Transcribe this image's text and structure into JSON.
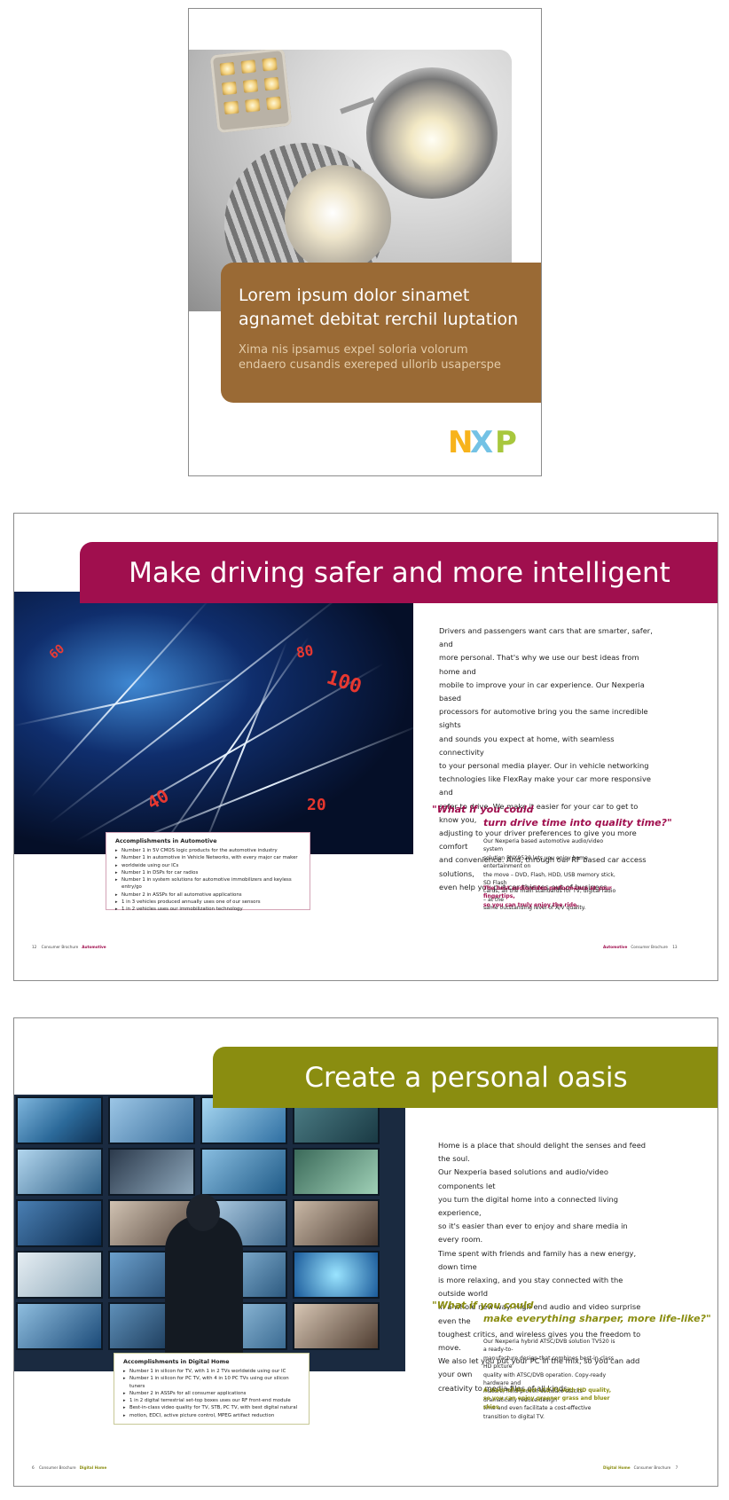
{
  "cover": {
    "title_line1": "Lorem ipsum dolor sinamet",
    "title_line2": "agnamet debitat rerchil luptation",
    "subtitle_line1": "Xima nis ipsamus expel soloria volorum",
    "subtitle_line2": "endaero cusandis exereped ullorib usaperspe",
    "logo_letters": [
      "N",
      "X",
      "P"
    ],
    "band_color": "#9a6a35",
    "logo_colors": [
      "#f7b31b",
      "#5bb7e0",
      "#9ec128"
    ]
  },
  "spread_automotive": {
    "banner": "Make driving safer and more intelligent",
    "banner_color": "#a00f4e",
    "body_lines": [
      "Drivers and passengers want cars that are smarter, safer, and",
      "more personal. That's why we use our best ideas from home and",
      "mobile to improve your in car experience. Our Nexperia based",
      "processors for automotive bring you the same incredible sights",
      "and sounds you expect at home, with seamless connectivity",
      "to your personal media player. Our in vehicle networking",
      "technologies like FlexRay make your car more responsive and",
      "safer to drive. We make it easier for your car to get to know you,",
      "adjusting to your driver preferences to give you more comfort",
      "and convenience. And, through our RF based car access solutions,",
      "even help you put car thieves out of business."
    ],
    "quote_line1": "\"What if you could",
    "quote_line2": "turn drive time into quality time?\"",
    "side_lines": [
      "Our Nexperia based automotive audio/video system",
      "solution PNX9520 lets you enjoy home entertainment on",
      "the move – DVD, Flash, HDD, USB memory stick, SD Flash",
      "cards, all the main standards for TV, digital radio – at the",
      "same outstanding level of A/V quality."
    ],
    "side_highlight_lines": [
      "The best audio/video performance at your fingertips,",
      "so you can truly enjoy the ride."
    ],
    "accomplishments_title": "Accomplishments in Automotive",
    "accomplishments": [
      "Number 1 in 5V CMOS logic products for the automotive industry",
      "Number 1 in automotive in Vehicle Networks, with every major car maker",
      "worldwide using our ICs",
      "Number 1 in DSPs for car radios",
      "Number 1 in system solutions for automotive immobilizers and keyless entry/go",
      "Number 2 in ASSPs for all automotive applications",
      "1 in 3 vehicles produced annually uses one of our sensors",
      "1 in 2 vehicles uses our immobilization technology"
    ],
    "folio_left_num": "12",
    "folio_left_pub": "Consumer Brochure",
    "folio_left_section": "Automotive",
    "folio_right_section": "Automotive",
    "folio_right_pub": "Consumer Brochure",
    "folio_right_num": "13"
  },
  "spread_home": {
    "banner": "Create a personal oasis",
    "banner_color": "#8a8d10",
    "body_lines": [
      "Home is a place that should delight the senses and feed the soul.",
      "Our Nexperia based solutions and audio/video components let",
      "you turn the digital home into a connected living experience,",
      "so it's easier than ever to enjoy and share media in every room.",
      "Time spent with friends and family has a new energy, down time",
      "is more relaxing, and you stay connected with the outside world",
      "in a whole new way. High end audio and video surprise even the",
      "toughest critics, and wireless gives you the freedom to move.",
      "We also let you put your PC in the mix, so you can add your own",
      "creativity to media files of all kinds."
    ],
    "quote_line1": "\"What if you could",
    "quote_line2": "make everything sharper, more life-like?\"",
    "side_lines": [
      "Our Nexperia hybrid ATSC/DVB solution TV520 is a ready-to-",
      "manufacture design that combines best-in-class HD picture",
      "quality with ATSC/DVB operation. Copy-ready hardware and",
      "mature, field-proven software stacks dramatically reduce design",
      "time and even facilitate a cost-effective transition to digital TV."
    ],
    "side_highlight_lines": [
      "A state-of-the-art LCD TV with HD quality,",
      "so you can enjoy greener grass and bluer skies."
    ],
    "accomplishments_title": "Accomplishments in Digital Home",
    "accomplishments": [
      "Number 1 in silicon for TV, with 1 in 2 TVs worldwide using our IC",
      "Number 1 in silicon for PC TV, with 4 in 10 PC TVs using our silicon tuners",
      "Number 2 in ASSPs for all consumer applications",
      "1 in 2 digital terrestrial set-top boxes uses our RF front-end module",
      "Best-in-class video quality for TV, STB, PC TV, with best digital natural",
      "motion, EDCI, active picture control, MPEG artifact reduction"
    ],
    "folio_left_num": "6",
    "folio_left_pub": "Consumer Brochure",
    "folio_left_section": "Digital Home",
    "folio_right_section": "Digital Home",
    "folio_right_pub": "Consumer Brochure",
    "folio_right_num": "7"
  }
}
